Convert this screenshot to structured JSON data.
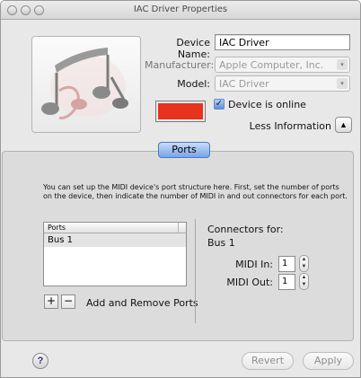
{
  "window": {
    "title": "IAC Driver Properties"
  },
  "device": {
    "name_label": "Device Name:",
    "name_value": "IAC Driver",
    "manufacturer_label": "Manufacturer:",
    "manufacturer_value": "Apple Computer, Inc.",
    "model_label": "Model:",
    "model_value": "IAC Driver",
    "online_label": "Device is online",
    "online_checked": true,
    "color": "#e8331e",
    "less_info_label": "Less Information"
  },
  "ports_section": {
    "tab_label": "Ports",
    "description": "You can set up the MIDI device's port structure here.  First, set the number of ports on the device, then indicate the number of MIDI in and out connectors for each port.",
    "table_header": "Ports",
    "rows": [
      "Bus 1"
    ],
    "add_label": "+",
    "remove_label": "−",
    "add_remove_label": "Add and Remove Ports",
    "connectors_label": "Connectors for:",
    "selected_port": "Bus 1",
    "midi_in_label": "MIDI In:",
    "midi_in_value": "1",
    "midi_out_label": "MIDI Out:",
    "midi_out_value": "1"
  },
  "footer": {
    "help_label": "?",
    "revert_label": "Revert",
    "apply_label": "Apply"
  },
  "icons": [
    "close-icon",
    "minimize-icon",
    "zoom-icon",
    "music-notes-icon",
    "popup-arrows-icon",
    "disclosure-up-icon",
    "stepper-icon",
    "help-icon"
  ]
}
